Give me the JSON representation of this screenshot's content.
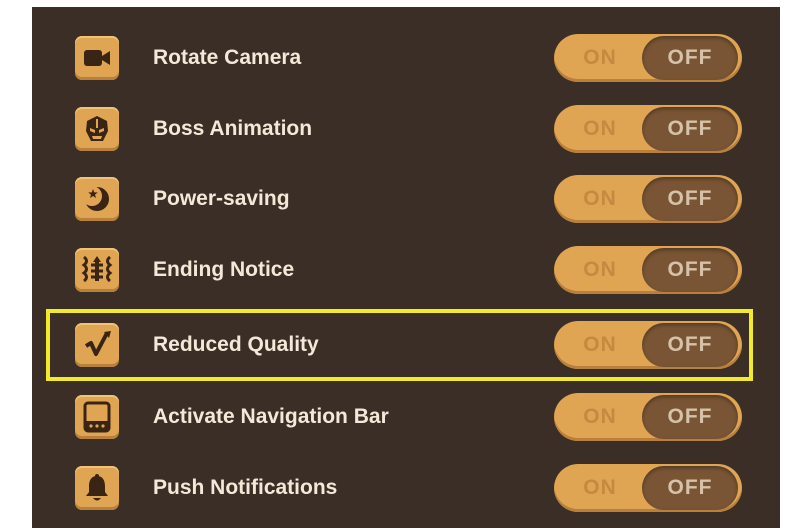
{
  "settings": [
    {
      "label": "Rotate Camera",
      "icon": "camera-icon",
      "state": "OFF"
    },
    {
      "label": "Boss Animation",
      "icon": "boss-helmet-icon",
      "state": "OFF"
    },
    {
      "label": "Power-saving",
      "icon": "moon-icon",
      "state": "OFF"
    },
    {
      "label": "Ending Notice",
      "icon": "ending-notice-icon",
      "state": "OFF"
    },
    {
      "label": "Reduced Quality",
      "icon": "quality-check-icon",
      "state": "OFF"
    },
    {
      "label": "Activate Navigation Bar",
      "icon": "navigation-bar-icon",
      "state": "OFF"
    },
    {
      "label": "Push Notifications",
      "icon": "bell-icon",
      "state": "OFF"
    }
  ],
  "toggle": {
    "on_label": "ON",
    "off_label": "OFF"
  },
  "highlighted_setting": "Reduced Quality",
  "colors": {
    "panel": "#3a2e26",
    "accent": "#e0a552",
    "off_knob": "#7a5535",
    "label_text": "#f4e9d8",
    "highlight": "#f2ea2a"
  }
}
